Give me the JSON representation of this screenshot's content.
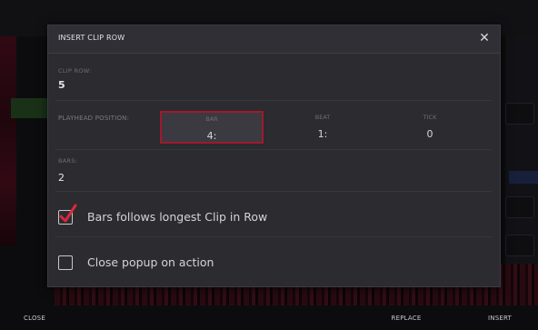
{
  "dialog": {
    "title": "INSERT CLIP ROW",
    "close_glyph": "✕"
  },
  "clip_row": {
    "label": "CLIP ROW:",
    "value": "5"
  },
  "playhead": {
    "label": "PLAYHEAD POSITION:",
    "bar": {
      "label": "BAR",
      "value": "4:"
    },
    "beat": {
      "label": "BEAT",
      "value": "1:"
    },
    "tick": {
      "label": "TICK",
      "value": "0"
    }
  },
  "bars": {
    "label": "BARS:",
    "value": "2"
  },
  "options": {
    "follows_longest": {
      "label": "Bars follows longest Clip in Row",
      "checked": true
    },
    "close_popup": {
      "label": "Close popup on action",
      "checked": false
    }
  },
  "footer": {
    "close_label": "CLOSE",
    "replace_label": "REPLACE",
    "insert_label": "INSERT"
  },
  "colors": {
    "accent": "#a0192e",
    "dialog_bg": "#2b2b30",
    "check_red": "#d8283c"
  },
  "icons": {
    "close": "close-icon",
    "check": "checkmark-icon"
  }
}
